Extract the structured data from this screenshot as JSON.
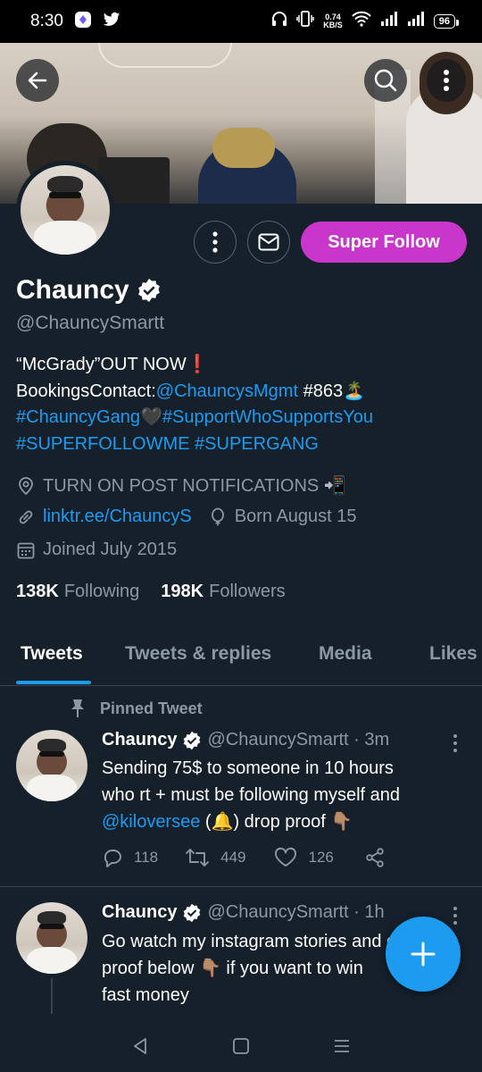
{
  "status_bar": {
    "time": "8:30",
    "speed_value": "0.74",
    "speed_unit": "KB/S",
    "battery": "96"
  },
  "profile": {
    "display_name": "Chauncy",
    "handle": "@ChauncySmartt",
    "super_follow_label": "Super Follow",
    "bio": {
      "line1": "“McGrady”OUT NOW❗",
      "line2_text": "BookingsContact:",
      "line2_link": "@ChauncysMgmt",
      "line2_tail": " #863🏝️",
      "line3_link1": "#ChauncyGang",
      "line3_heart": "🖤",
      "line3_link2": "#SupportWhoSupportsYou",
      "line4_link1": "#SUPERFOLLOWME",
      "line4_link2": "#SUPERGANG"
    },
    "location": "TURN ON POST NOTIFICATIONS 📲",
    "website": "linktr.ee/ChauncyS",
    "birthday": "Born August 15",
    "joined": "Joined July 2015",
    "following_count": "138K",
    "following_label": "Following",
    "followers_count": "198K",
    "followers_label": "Followers"
  },
  "tabs": [
    {
      "label": "Tweets",
      "active": true
    },
    {
      "label": "Tweets & replies",
      "active": false
    },
    {
      "label": "Media",
      "active": false
    },
    {
      "label": "Likes",
      "active": false
    }
  ],
  "tweets": [
    {
      "pinned_label": "Pinned Tweet",
      "name": "Chauncy",
      "handle_time": "@ChauncySmartt · 3m",
      "text_line1": "Sending 75$ to someone in 10 hours",
      "text_line2": "who rt + must be following myself and",
      "text_mention": "@kiloversee",
      "text_tail": " (🔔) drop proof 👇🏽",
      "replies": "118",
      "retweets": "449",
      "likes": "126"
    },
    {
      "name": "Chauncy",
      "handle_time": "@ChauncySmartt · 1h",
      "text_line1": "Go watch my instagram stories and drop",
      "text_line2": "proof below 👇🏽 if you want to win",
      "text_line3": "fast money"
    }
  ],
  "colors": {
    "background": "#15202b",
    "accent": "#1d9bf0",
    "super_follow": "#c936cc",
    "muted": "#8b98a5"
  }
}
